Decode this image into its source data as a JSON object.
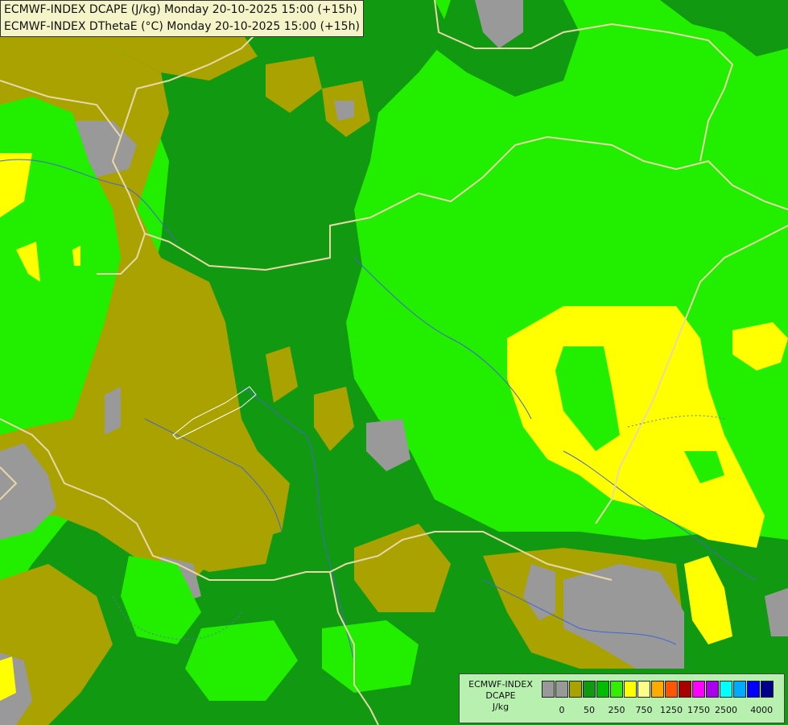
{
  "header": {
    "line1": "ECMWF-INDEX DCAPE (J/kg) Monday 20-10-2025 15:00 (+15h)",
    "line2": "ECMWF-INDEX DThetaE (°C) Monday 20-10-2025 15:00 (+15h)"
  },
  "legend": {
    "name_line1": "ECMWF-INDEX",
    "name_line2": "DCAPE",
    "unit": "J/kg",
    "colors": [
      "#999999",
      "#999999",
      "#aaa200",
      "#119911",
      "#00bb00",
      "#33ee00",
      "#ffff00",
      "#ffff88",
      "#ffaa00",
      "#ff5500",
      "#aa0000",
      "#ff00ff",
      "#aa00ee",
      "#00ffff",
      "#00aaff",
      "#0000ff",
      "#000088"
    ],
    "tick_labels": [
      "0",
      "50",
      "250",
      "750",
      "1250",
      "1750",
      "2500",
      "4000"
    ]
  },
  "map_colors": {
    "light_green": "#22ee00",
    "dark_green": "#119911",
    "olive": "#aaa200",
    "grey": "#999999",
    "yellow": "#ffff00",
    "border": "#e8d8a8",
    "river": "#4466cc"
  }
}
